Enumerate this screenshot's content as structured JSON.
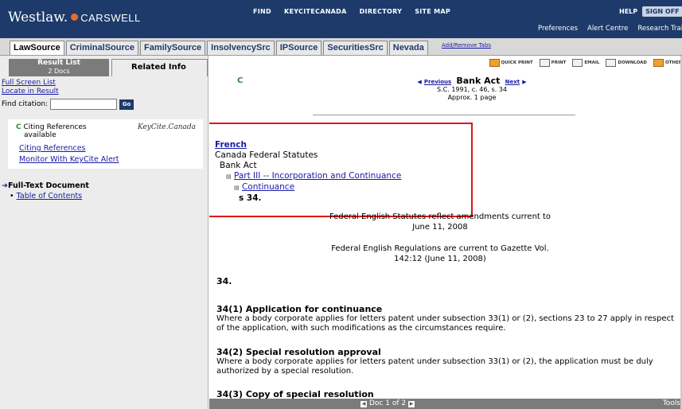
{
  "header": {
    "logo_main": "Westlaw.",
    "logo_partner": "CARSWELL",
    "topnav": [
      "FIND",
      "KEYCITECANADA",
      "DIRECTORY",
      "SITE MAP"
    ],
    "help": "HELP",
    "signoff": "SIGN OFF",
    "subnav": [
      "Preferences",
      "Alert Centre",
      "Research Trail"
    ]
  },
  "tabs": [
    "LawSource",
    "CriminalSource",
    "FamilySource",
    "InsolvencySrc",
    "IPSource",
    "SecuritiesSrc",
    "Nevada"
  ],
  "add_remove_tabs": "Add/Remove Tabs",
  "left": {
    "result_list": "Result List",
    "result_count": "2 Docs",
    "related_info": "Related Info",
    "full_screen_list": "Full Screen List",
    "locate_in_result": "Locate in Result",
    "find_citation": "Find citation:",
    "go": "Go",
    "keycite": {
      "flag": "C",
      "line1": "Citing References",
      "line2": "available",
      "logo": "KeyCite.Canada",
      "citing_references": "Citing References",
      "monitor": "Monitor With KeyCite Alert"
    },
    "full_text_document": "Full-Text Document",
    "table_of_contents": "Table of Contents"
  },
  "toolbar": {
    "quick_print": "QUICK PRINT",
    "print": "PRINT",
    "email": "EMAIL",
    "download": "DOWNLOAD",
    "other": "OTHER"
  },
  "doc": {
    "flag": "C",
    "previous": "Previous",
    "title": "Bank Act",
    "next": "Next",
    "citation": "S.C. 1991, c. 46, s. 34",
    "length": "Approx. 1 page",
    "hierarchy": {
      "french": "French",
      "collection": "Canada Federal Statutes",
      "act": "Bank Act",
      "part": "Part III -- Incorporation and Continuance",
      "subpart": "Continuance",
      "section": "s 34."
    },
    "currency_statutes": "Federal English Statutes reflect amendments current to June 11, 2008",
    "currency_regulations": "Federal English Regulations are current to Gazette Vol. 142:12 (June 11, 2008)",
    "section_number": "34.",
    "paragraphs": [
      {
        "heading": "34(1) Application for continuance",
        "text": "Where a body corporate applies for letters patent under subsection 33(1) or (2), sections 23 to 27 apply in respect of the application, with such modifications as the circumstances require."
      },
      {
        "heading": "34(2) Special resolution approval",
        "text": "Where a body corporate applies for letters patent under subsection 33(1) or (2), the application must be duly authorized by a special resolution."
      },
      {
        "heading": "34(3) Copy of special resolution",
        "text": ""
      }
    ]
  },
  "bottom": {
    "doc_position": "Doc 1 of 2",
    "tools": "Tools"
  }
}
